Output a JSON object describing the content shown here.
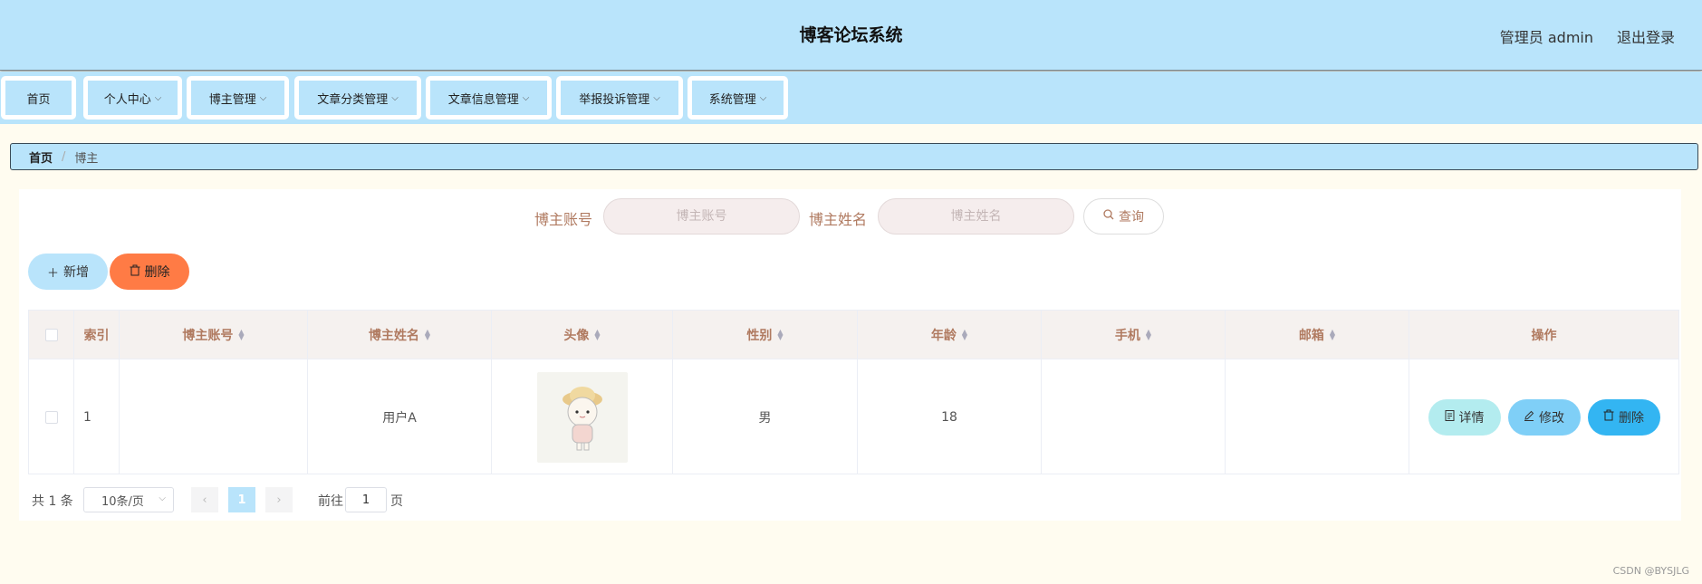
{
  "header": {
    "title": "博客论坛系统",
    "user": "管理员 admin",
    "logout": "退出登录"
  },
  "menu": [
    {
      "label": "首页"
    },
    {
      "label": "个人中心"
    },
    {
      "label": "博主管理"
    },
    {
      "label": "文章分类管理"
    },
    {
      "label": "文章信息管理"
    },
    {
      "label": "举报投诉管理"
    },
    {
      "label": "系统管理"
    }
  ],
  "breadcrumb": {
    "home": "首页",
    "separator": "/",
    "current": "博主"
  },
  "search": {
    "account_label": "博主账号",
    "account_placeholder": "博主账号",
    "name_label": "博主姓名",
    "name_placeholder": "博主姓名",
    "query": "查询"
  },
  "actions": {
    "add": "新增",
    "delete": "删除"
  },
  "table": {
    "headers": {
      "index": "索引",
      "account": "博主账号",
      "name": "博主姓名",
      "avatar": "头像",
      "gender": "性别",
      "age": "年龄",
      "phone": "手机",
      "email": "邮箱",
      "ops": "操作"
    },
    "rows": [
      {
        "index": "1",
        "account": "",
        "name": "用户A",
        "gender": "男",
        "age": "18",
        "phone": "",
        "email": "",
        "detail": "详情",
        "edit": "修改",
        "delete": "删除"
      }
    ]
  },
  "pagination": {
    "total": "共 1 条",
    "page_size": "10条/页",
    "current_page": "1",
    "goto_label": "前往",
    "goto_value": "1",
    "goto_unit": "页"
  },
  "watermark": "CSDN @BYSJLG",
  "colors": {
    "header_bg": "#b9e4fb",
    "accent_orange": "#ff7b45",
    "label_brown": "#b07a60",
    "page_bg": "#fffcf0"
  }
}
